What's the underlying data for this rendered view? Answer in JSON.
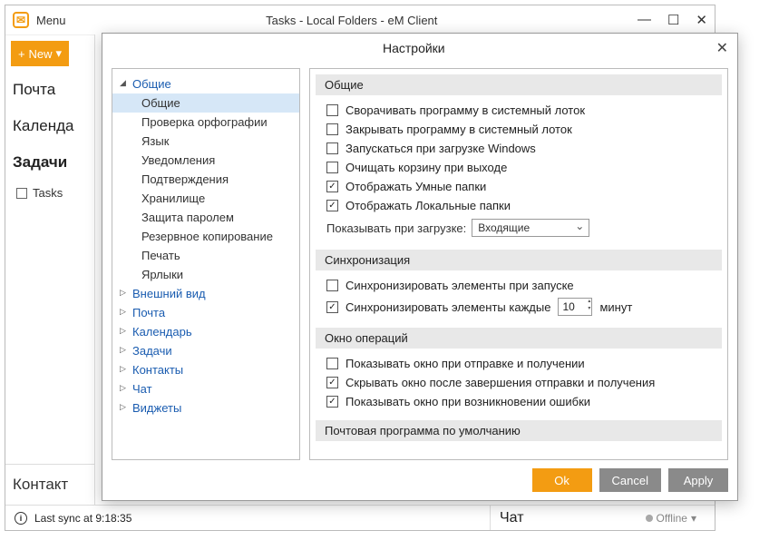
{
  "main": {
    "menu_label": "Menu",
    "title": "Tasks - Local Folders - eM Client",
    "new_button": "New",
    "new_button_plus": "+",
    "new_button_caret": "▾",
    "nav": {
      "mail": "Почта",
      "calendar": "Календа",
      "tasks": "Задачи",
      "tasks_folder": "Tasks",
      "contacts": "Контакт"
    },
    "status": {
      "last_sync": "Last sync at 9:18:35",
      "chat_label": "Чат",
      "offline": "Offline",
      "offline_caret": "▾"
    },
    "win": {
      "min": "—",
      "max": "☐",
      "close": "✕"
    }
  },
  "dialog": {
    "title": "Настройки",
    "close": "✕",
    "tree": {
      "general": {
        "label": "Общие",
        "expanded": true
      },
      "children": [
        "Общие",
        "Проверка орфографии",
        "Язык",
        "Уведомления",
        "Подтверждения",
        "Хранилище",
        "Защита паролем",
        "Резервное копирование",
        "Печать",
        "Ярлыки"
      ],
      "appearance": "Внешний вид",
      "mail": "Почта",
      "calendar": "Календарь",
      "tasks": "Задачи",
      "contacts": "Контакты",
      "chat": "Чат",
      "widgets": "Виджеты"
    },
    "sections": {
      "general": {
        "header": "Общие",
        "items": [
          {
            "label": "Сворачивать программу в системный лоток",
            "checked": false
          },
          {
            "label": "Закрывать программу в системный лоток",
            "checked": false
          },
          {
            "label": "Запускаться при загрузке Windows",
            "checked": false
          },
          {
            "label": "Очищать корзину при выходе",
            "checked": false
          },
          {
            "label": "Отображать Умные папки",
            "checked": true
          },
          {
            "label": "Отображать Локальные папки",
            "checked": true
          }
        ],
        "startup_label": "Показывать при загрузке:",
        "startup_value": "Входящие"
      },
      "sync": {
        "header": "Синхронизация",
        "items": [
          {
            "label": "Синхронизировать элементы при запуске",
            "checked": false
          }
        ],
        "interval": {
          "label_left": "Синхронизировать элементы каждые",
          "value": "10",
          "label_right": "минут",
          "checked": true
        }
      },
      "ops": {
        "header": "Окно операций",
        "items": [
          {
            "label": "Показывать окно при отправке и получении",
            "checked": false
          },
          {
            "label": "Скрывать окно после завершения отправки и получения",
            "checked": true
          },
          {
            "label": "Показывать окно при возникновении ошибки",
            "checked": true
          }
        ]
      },
      "default_mail": {
        "header": "Почтовая программа по умолчанию"
      }
    },
    "buttons": {
      "ok": "Ok",
      "cancel": "Cancel",
      "apply": "Apply"
    }
  }
}
